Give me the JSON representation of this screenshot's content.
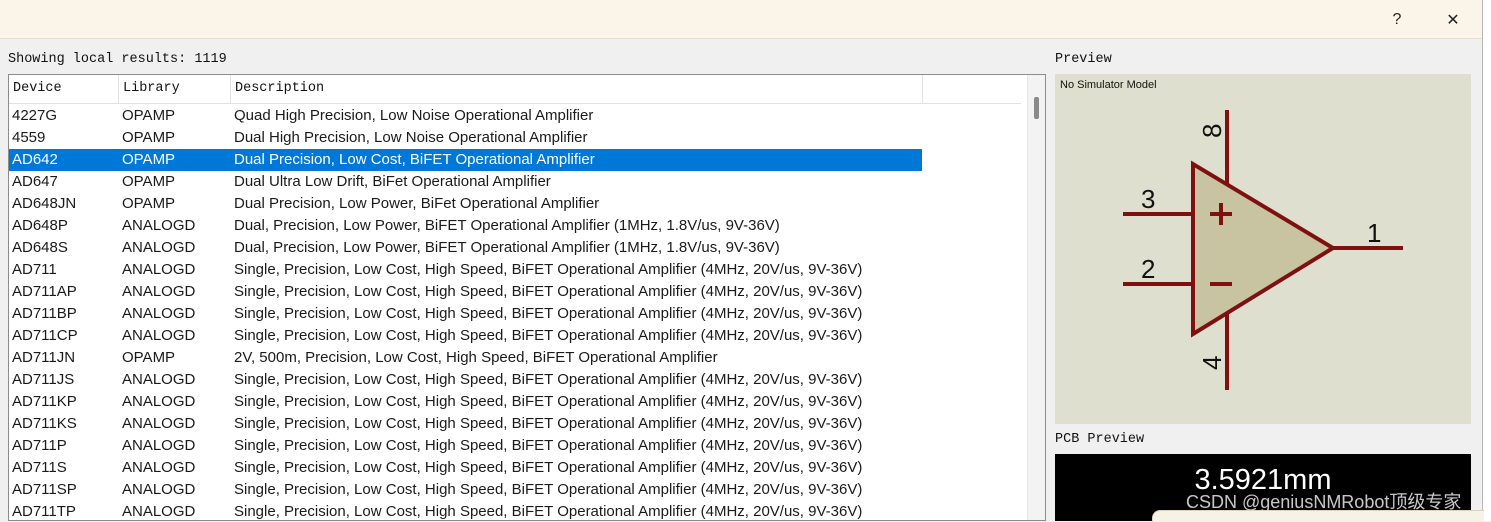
{
  "titlebar": {
    "help_glyph": "?",
    "close_glyph": "✕"
  },
  "results_label": "Showing local results: 1119",
  "columns": [
    "Device",
    "Library",
    "Description"
  ],
  "rows": [
    {
      "device": "4227G",
      "library": "OPAMP",
      "description": "Quad High Precision, Low Noise Operational Amplifier"
    },
    {
      "device": "4559",
      "library": "OPAMP",
      "description": "Dual High Precision, Low Noise Operational Amplifier"
    },
    {
      "device": "AD642",
      "library": "OPAMP",
      "description": "Dual Precision, Low Cost, BiFET Operational Amplifier",
      "selected": true
    },
    {
      "device": "AD647",
      "library": "OPAMP",
      "description": "Dual Ultra Low Drift, BiFet Operational Amplifier"
    },
    {
      "device": "AD648JN",
      "library": "OPAMP",
      "description": "Dual Precision, Low Power, BiFet Operational Amplifier"
    },
    {
      "device": "AD648P",
      "library": "ANALOGD",
      "description": "Dual, Precision, Low Power, BiFET Operational Amplifier (1MHz, 1.8V/us, 9V-36V)"
    },
    {
      "device": "AD648S",
      "library": "ANALOGD",
      "description": "Dual, Precision, Low Power, BiFET Operational Amplifier (1MHz, 1.8V/us, 9V-36V)"
    },
    {
      "device": "AD711",
      "library": "ANALOGD",
      "description": "Single, Precision, Low Cost, High Speed, BiFET Operational Amplifier (4MHz, 20V/us, 9V-36V)"
    },
    {
      "device": "AD711AP",
      "library": "ANALOGD",
      "description": "Single, Precision, Low Cost, High Speed, BiFET Operational Amplifier (4MHz, 20V/us, 9V-36V)"
    },
    {
      "device": "AD711BP",
      "library": "ANALOGD",
      "description": "Single, Precision, Low Cost, High Speed, BiFET Operational Amplifier (4MHz, 20V/us, 9V-36V)"
    },
    {
      "device": "AD711CP",
      "library": "ANALOGD",
      "description": "Single, Precision, Low Cost, High Speed, BiFET Operational Amplifier (4MHz, 20V/us, 9V-36V)"
    },
    {
      "device": "AD711JN",
      "library": "OPAMP",
      "description": "2V, 500m, Precision, Low Cost, High Speed, BiFET Operational Amplifier"
    },
    {
      "device": "AD711JS",
      "library": "ANALOGD",
      "description": "Single, Precision, Low Cost, High Speed, BiFET Operational Amplifier (4MHz, 20V/us, 9V-36V)"
    },
    {
      "device": "AD711KP",
      "library": "ANALOGD",
      "description": "Single, Precision, Low Cost, High Speed, BiFET Operational Amplifier (4MHz, 20V/us, 9V-36V)"
    },
    {
      "device": "AD711KS",
      "library": "ANALOGD",
      "description": "Single, Precision, Low Cost, High Speed, BiFET Operational Amplifier (4MHz, 20V/us, 9V-36V)"
    },
    {
      "device": "AD711P",
      "library": "ANALOGD",
      "description": "Single, Precision, Low Cost, High Speed, BiFET Operational Amplifier (4MHz, 20V/us, 9V-36V)"
    },
    {
      "device": "AD711S",
      "library": "ANALOGD",
      "description": "Single, Precision, Low Cost, High Speed, BiFET Operational Amplifier (4MHz, 20V/us, 9V-36V)"
    },
    {
      "device": "AD711SP",
      "library": "ANALOGD",
      "description": "Single, Precision, Low Cost, High Speed, BiFET Operational Amplifier (4MHz, 20V/us, 9V-36V)"
    },
    {
      "device": "AD711TP",
      "library": "ANALOGD",
      "description": "Single, Precision, Low Cost, High Speed, BiFET Operational Amplifier (4MHz, 20V/us, 9V-36V)"
    }
  ],
  "preview": {
    "label": "Preview",
    "no_model": "No Simulator Model",
    "pins": {
      "noninverting": "3",
      "inverting": "2",
      "output": "1",
      "v_pos": "8",
      "v_neg": "4"
    },
    "colors": {
      "body": "#c8c4a2",
      "stroke": "#7e1010",
      "background": "#dfdfcf"
    }
  },
  "pcb": {
    "label": "PCB Preview",
    "dimension": "3.5921mm"
  },
  "watermark": "CSDN @geniusNMRobot顶级专家",
  "colors": {
    "selection": "#0078d7",
    "titlebar": "#fbf5e9"
  }
}
